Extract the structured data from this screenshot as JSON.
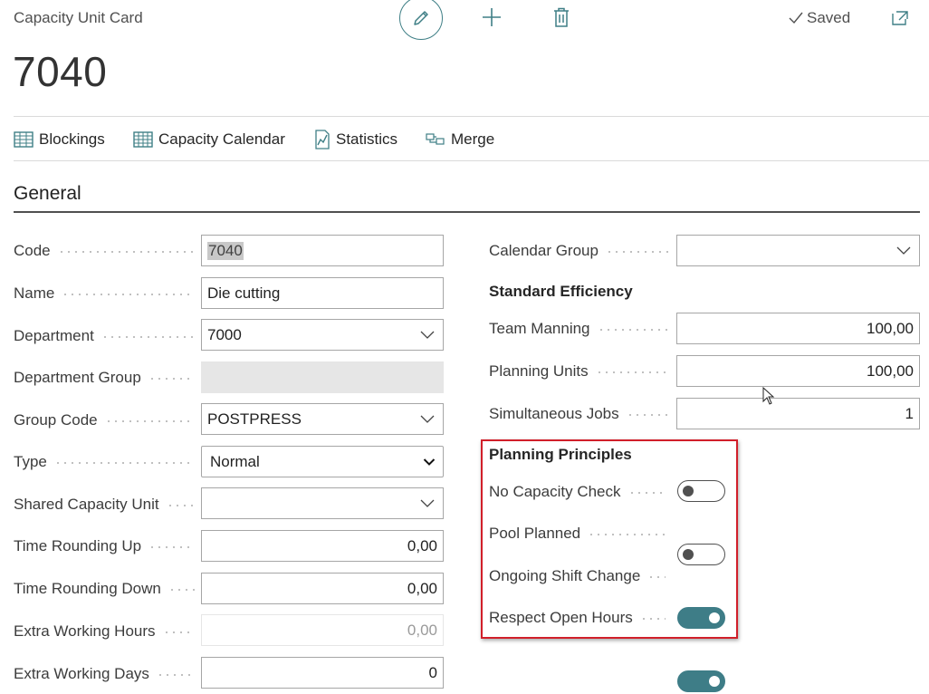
{
  "header": {
    "caption": "Capacity Unit Card",
    "title": "7040",
    "saved_label": "Saved"
  },
  "actions": [
    {
      "label": "Blockings",
      "icon": "table-icon"
    },
    {
      "label": "Capacity Calendar",
      "icon": "calendar-grid-icon"
    },
    {
      "label": "Statistics",
      "icon": "chart-doc-icon"
    },
    {
      "label": "Merge",
      "icon": "merge-icon"
    }
  ],
  "section": {
    "title": "General"
  },
  "left_fields": {
    "code": {
      "label": "Code",
      "value": "7040"
    },
    "name": {
      "label": "Name",
      "value": "Die cutting"
    },
    "department": {
      "label": "Department",
      "value": "7000"
    },
    "department_group": {
      "label": "Department Group",
      "value": ""
    },
    "group_code": {
      "label": "Group Code",
      "value": "POSTPRESS"
    },
    "type": {
      "label": "Type",
      "value": "Normal"
    },
    "shared_capacity_unit": {
      "label": "Shared Capacity Unit",
      "value": ""
    },
    "time_rounding_up": {
      "label": "Time Rounding Up",
      "value": "0,00"
    },
    "time_rounding_down": {
      "label": "Time Rounding Down",
      "value": "0,00"
    },
    "extra_working_hours": {
      "label": "Extra Working Hours",
      "value": "0,00"
    },
    "extra_working_days": {
      "label": "Extra Working Days",
      "value": "0"
    }
  },
  "right_fields": {
    "calendar_group": {
      "label": "Calendar Group",
      "value": ""
    },
    "standard_efficiency_heading": "Standard Efficiency",
    "team_manning": {
      "label": "Team Manning",
      "value": "100,00"
    },
    "planning_units": {
      "label": "Planning Units",
      "value": "100,00"
    },
    "simultaneous_jobs": {
      "label": "Simultaneous Jobs",
      "value": "1"
    },
    "planning_principles_heading": "Planning Principles",
    "no_capacity_check": {
      "label": "No Capacity Check",
      "on": false
    },
    "pool_planned": {
      "label": "Pool Planned",
      "on": false
    },
    "ongoing_shift_change": {
      "label": "Ongoing Shift Change",
      "on": true
    },
    "respect_open_hours": {
      "label": "Respect Open Hours",
      "on": true
    }
  },
  "colors": {
    "accent": "#3e7d87",
    "highlight": "#d11f2a"
  }
}
